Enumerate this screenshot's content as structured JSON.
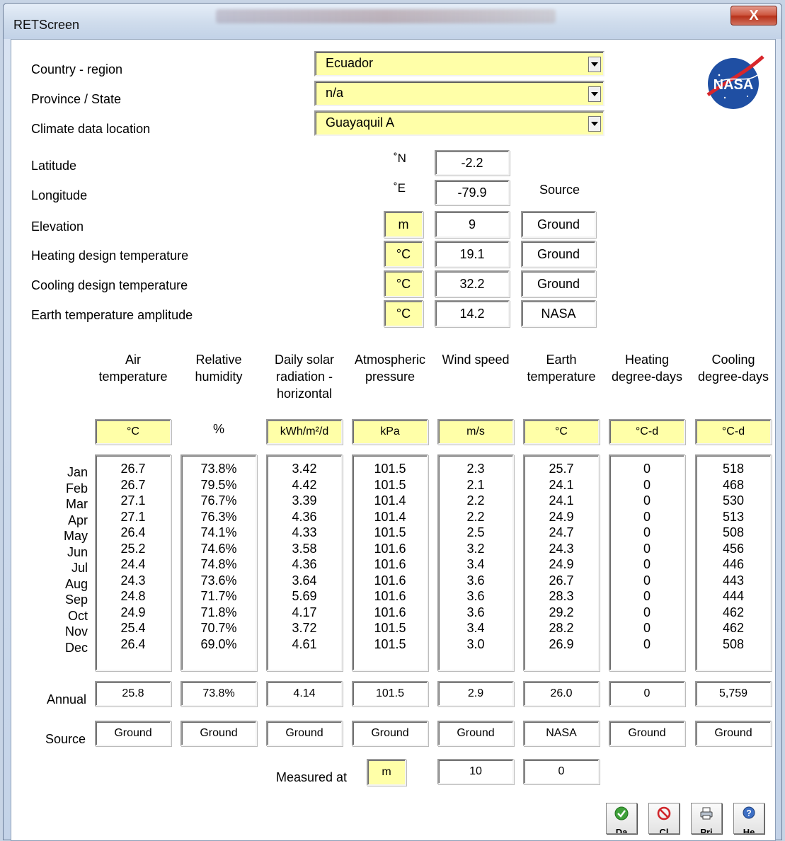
{
  "window": {
    "title": "RETScreen",
    "close_label": "X"
  },
  "location": {
    "country_label": "Country - region",
    "country_value": "Ecuador",
    "province_label": "Province / State",
    "province_value": "n/a",
    "climate_label": "Climate data location",
    "climate_value": "Guayaquil A"
  },
  "site": {
    "latitude_label": "Latitude",
    "latitude_unit": "˚N",
    "latitude_value": "-2.2",
    "longitude_label": "Longitude",
    "longitude_unit": "˚E",
    "longitude_value": "-79.9",
    "source_header": "Source",
    "elevation_label": "Elevation",
    "elevation_unit": "m",
    "elevation_value": "9",
    "elevation_source": "Ground",
    "heating_label": "Heating design temperature",
    "heating_unit": "°C",
    "heating_value": "19.1",
    "heating_source": "Ground",
    "cooling_label": "Cooling design temperature",
    "cooling_unit": "°C",
    "cooling_value": "32.2",
    "cooling_source": "Ground",
    "earth_label": "Earth temperature amplitude",
    "earth_unit": "°C",
    "earth_value": "14.2",
    "earth_source": "NASA"
  },
  "table": {
    "months": [
      "Jan",
      "Feb",
      "Mar",
      "Apr",
      "May",
      "Jun",
      "Jul",
      "Aug",
      "Sep",
      "Oct",
      "Nov",
      "Dec"
    ],
    "annual_label": "Annual",
    "source_label": "Source",
    "measured_label": "Measured at",
    "measured_unit": "m",
    "columns": [
      {
        "header": [
          "Air",
          "temperature"
        ],
        "unit": "°C",
        "unit_yellow": true,
        "values": [
          "26.7",
          "26.7",
          "27.1",
          "27.1",
          "26.4",
          "25.2",
          "24.4",
          "24.3",
          "24.8",
          "24.9",
          "25.4",
          "26.4"
        ],
        "annual": "25.8",
        "source": "Ground"
      },
      {
        "header": [
          "Relative",
          "humidity"
        ],
        "unit": "%",
        "unit_yellow": false,
        "values": [
          "73.8%",
          "79.5%",
          "76.7%",
          "76.3%",
          "74.1%",
          "74.6%",
          "74.8%",
          "73.6%",
          "71.7%",
          "71.8%",
          "70.7%",
          "69.0%"
        ],
        "annual": "73.8%",
        "source": "Ground"
      },
      {
        "header": [
          "Daily solar",
          "radiation -",
          "horizontal"
        ],
        "unit": "kWh/m²/d",
        "unit_yellow": true,
        "values": [
          "3.42",
          "4.42",
          "3.39",
          "4.36",
          "4.33",
          "3.58",
          "4.36",
          "3.64",
          "5.69",
          "4.17",
          "3.72",
          "4.61"
        ],
        "annual": "4.14",
        "source": "Ground"
      },
      {
        "header": [
          "Atmospheric",
          "pressure"
        ],
        "unit": "kPa",
        "unit_yellow": true,
        "values": [
          "101.5",
          "101.5",
          "101.4",
          "101.4",
          "101.5",
          "101.6",
          "101.6",
          "101.6",
          "101.6",
          "101.6",
          "101.5",
          "101.5"
        ],
        "annual": "101.5",
        "source": "Ground"
      },
      {
        "header": [
          "Wind speed"
        ],
        "unit": "m/s",
        "unit_yellow": true,
        "values": [
          "2.3",
          "2.1",
          "2.2",
          "2.2",
          "2.5",
          "3.2",
          "3.4",
          "3.6",
          "3.6",
          "3.6",
          "3.4",
          "3.0"
        ],
        "annual": "2.9",
        "source": "Ground",
        "measured": "10"
      },
      {
        "header": [
          "Earth",
          "temperature"
        ],
        "unit": "°C",
        "unit_yellow": true,
        "values": [
          "25.7",
          "24.1",
          "24.1",
          "24.9",
          "24.7",
          "24.3",
          "24.9",
          "26.7",
          "28.3",
          "29.2",
          "28.2",
          "26.9"
        ],
        "annual": "26.0",
        "source": "NASA",
        "measured": "0"
      },
      {
        "header": [
          "Heating",
          "degree-days"
        ],
        "unit": "°C-d",
        "unit_yellow": true,
        "values": [
          "0",
          "0",
          "0",
          "0",
          "0",
          "0",
          "0",
          "0",
          "0",
          "0",
          "0",
          "0"
        ],
        "annual": "0",
        "source": "Ground"
      },
      {
        "header": [
          "Cooling",
          "degree-days"
        ],
        "unit": "°C-d",
        "unit_yellow": true,
        "values": [
          "518",
          "468",
          "530",
          "513",
          "508",
          "456",
          "446",
          "443",
          "444",
          "462",
          "462",
          "508"
        ],
        "annual": "5,759",
        "source": "Ground"
      }
    ]
  },
  "buttons": [
    {
      "icon": "check-icon",
      "label": "Da"
    },
    {
      "icon": "cancel-icon",
      "label": "Cl"
    },
    {
      "icon": "print-icon",
      "label": "Pri"
    },
    {
      "icon": "help-icon",
      "label": "He"
    }
  ],
  "logo": {
    "text": "NASA"
  },
  "colors": {
    "input_yellow": "#ffffa8",
    "close_red": "#c8402a",
    "nasa_blue": "#1f4fa3"
  }
}
